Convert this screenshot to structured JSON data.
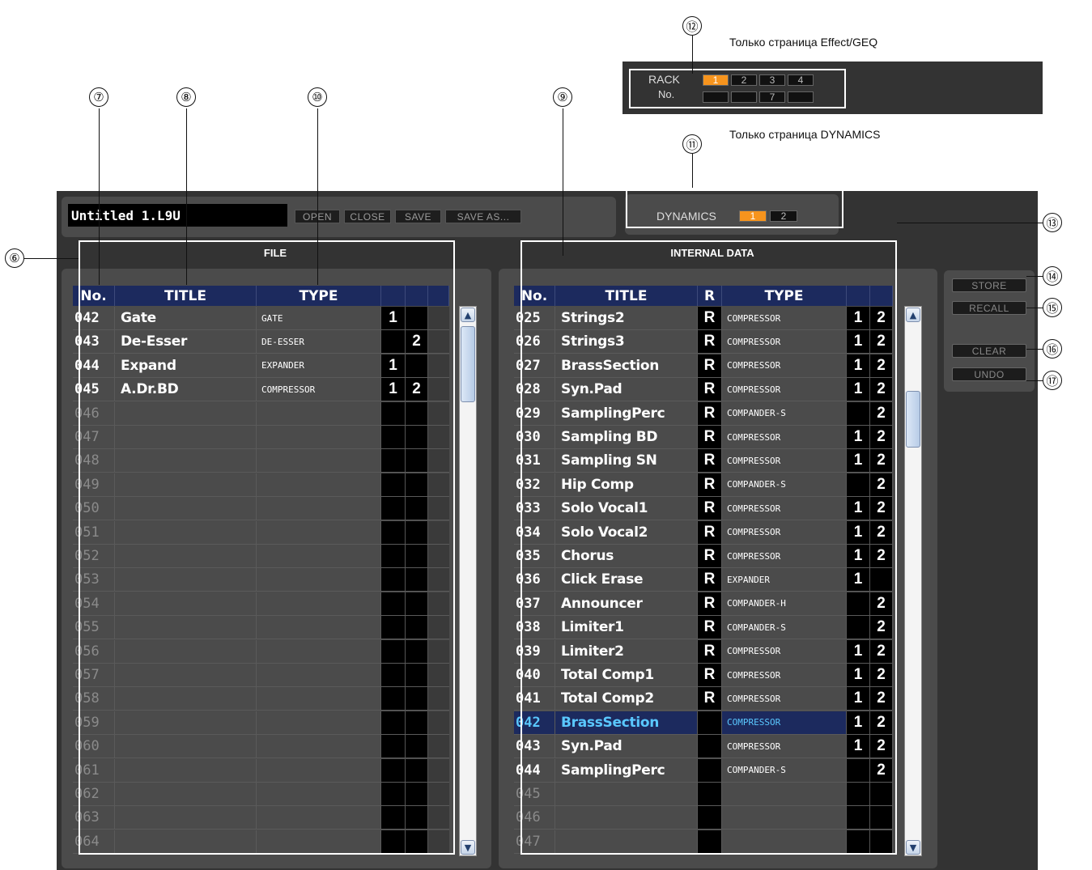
{
  "notes": {
    "effect_geq_only": "Только страница Effect/GEQ",
    "dynamics_only": "Только страница DYNAMICS"
  },
  "callouts": [
    "⑥",
    "⑦",
    "⑧",
    "⑨",
    "⑩",
    "⑪",
    "⑫",
    "⑬",
    "⑭",
    "⑮",
    "⑯",
    "⑰"
  ],
  "rack": {
    "label_line1": "RACK",
    "label_line2": "No.",
    "top_buttons": [
      "1",
      "2",
      "3",
      "4"
    ],
    "bottom_buttons": [
      "",
      "",
      "7",
      ""
    ],
    "active": "1",
    "active_color": "#f7941d"
  },
  "file_bar": {
    "filename": "Untitled 1.L9U",
    "open_label": "OPEN",
    "close_label": "CLOSE",
    "save_label": "SAVE",
    "save_as_label": "SAVE AS..."
  },
  "dynamics": {
    "label": "DYNAMICS",
    "buttons": [
      "1",
      "2"
    ],
    "active": "1"
  },
  "file_panel": {
    "title": "FILE",
    "headers": {
      "no": "No.",
      "title": "TITLE",
      "type": "TYPE"
    },
    "rows": [
      {
        "no": "042",
        "title": "Gate",
        "type": "GATE",
        "ch1": "1",
        "ch2": ""
      },
      {
        "no": "043",
        "title": "De-Esser",
        "type": "DE-ESSER",
        "ch1": "",
        "ch2": "2"
      },
      {
        "no": "044",
        "title": "Expand",
        "type": "EXPANDER",
        "ch1": "1",
        "ch2": ""
      },
      {
        "no": "045",
        "title": "A.Dr.BD",
        "type": "COMPRESSOR",
        "ch1": "1",
        "ch2": "2"
      },
      {
        "no": "046",
        "title": "",
        "type": "",
        "ch1": "",
        "ch2": ""
      },
      {
        "no": "047",
        "title": "",
        "type": "",
        "ch1": "",
        "ch2": ""
      },
      {
        "no": "048",
        "title": "",
        "type": "",
        "ch1": "",
        "ch2": ""
      },
      {
        "no": "049",
        "title": "",
        "type": "",
        "ch1": "",
        "ch2": ""
      },
      {
        "no": "050",
        "title": "",
        "type": "",
        "ch1": "",
        "ch2": ""
      },
      {
        "no": "051",
        "title": "",
        "type": "",
        "ch1": "",
        "ch2": ""
      },
      {
        "no": "052",
        "title": "",
        "type": "",
        "ch1": "",
        "ch2": ""
      },
      {
        "no": "053",
        "title": "",
        "type": "",
        "ch1": "",
        "ch2": ""
      },
      {
        "no": "054",
        "title": "",
        "type": "",
        "ch1": "",
        "ch2": ""
      },
      {
        "no": "055",
        "title": "",
        "type": "",
        "ch1": "",
        "ch2": ""
      },
      {
        "no": "056",
        "title": "",
        "type": "",
        "ch1": "",
        "ch2": ""
      },
      {
        "no": "057",
        "title": "",
        "type": "",
        "ch1": "",
        "ch2": ""
      },
      {
        "no": "058",
        "title": "",
        "type": "",
        "ch1": "",
        "ch2": ""
      },
      {
        "no": "059",
        "title": "",
        "type": "",
        "ch1": "",
        "ch2": ""
      },
      {
        "no": "060",
        "title": "",
        "type": "",
        "ch1": "",
        "ch2": ""
      },
      {
        "no": "061",
        "title": "",
        "type": "",
        "ch1": "",
        "ch2": ""
      },
      {
        "no": "062",
        "title": "",
        "type": "",
        "ch1": "",
        "ch2": ""
      },
      {
        "no": "063",
        "title": "",
        "type": "",
        "ch1": "",
        "ch2": ""
      },
      {
        "no": "064",
        "title": "",
        "type": "",
        "ch1": "",
        "ch2": ""
      }
    ]
  },
  "internal_panel": {
    "title": "INTERNAL DATA",
    "headers": {
      "no": "No.",
      "title": "TITLE",
      "r": "R",
      "type": "TYPE"
    },
    "rows": [
      {
        "no": "025",
        "title": "Strings2",
        "r": "R",
        "type": "COMPRESSOR",
        "ch1": "1",
        "ch2": "2"
      },
      {
        "no": "026",
        "title": "Strings3",
        "r": "R",
        "type": "COMPRESSOR",
        "ch1": "1",
        "ch2": "2"
      },
      {
        "no": "027",
        "title": "BrassSection",
        "r": "R",
        "type": "COMPRESSOR",
        "ch1": "1",
        "ch2": "2"
      },
      {
        "no": "028",
        "title": "Syn.Pad",
        "r": "R",
        "type": "COMPRESSOR",
        "ch1": "1",
        "ch2": "2"
      },
      {
        "no": "029",
        "title": "SamplingPerc",
        "r": "R",
        "type": "COMPANDER-S",
        "ch1": "",
        "ch2": "2"
      },
      {
        "no": "030",
        "title": "Sampling BD",
        "r": "R",
        "type": "COMPRESSOR",
        "ch1": "1",
        "ch2": "2"
      },
      {
        "no": "031",
        "title": "Sampling SN",
        "r": "R",
        "type": "COMPRESSOR",
        "ch1": "1",
        "ch2": "2"
      },
      {
        "no": "032",
        "title": "Hip Comp",
        "r": "R",
        "type": "COMPANDER-S",
        "ch1": "",
        "ch2": "2"
      },
      {
        "no": "033",
        "title": "Solo Vocal1",
        "r": "R",
        "type": "COMPRESSOR",
        "ch1": "1",
        "ch2": "2"
      },
      {
        "no": "034",
        "title": "Solo Vocal2",
        "r": "R",
        "type": "COMPRESSOR",
        "ch1": "1",
        "ch2": "2"
      },
      {
        "no": "035",
        "title": "Chorus",
        "r": "R",
        "type": "COMPRESSOR",
        "ch1": "1",
        "ch2": "2"
      },
      {
        "no": "036",
        "title": "Click Erase",
        "r": "R",
        "type": "EXPANDER",
        "ch1": "1",
        "ch2": ""
      },
      {
        "no": "037",
        "title": "Announcer",
        "r": "R",
        "type": "COMPANDER-H",
        "ch1": "",
        "ch2": "2"
      },
      {
        "no": "038",
        "title": "Limiter1",
        "r": "R",
        "type": "COMPANDER-S",
        "ch1": "",
        "ch2": "2"
      },
      {
        "no": "039",
        "title": "Limiter2",
        "r": "R",
        "type": "COMPRESSOR",
        "ch1": "1",
        "ch2": "2"
      },
      {
        "no": "040",
        "title": "Total Comp1",
        "r": "R",
        "type": "COMPRESSOR",
        "ch1": "1",
        "ch2": "2"
      },
      {
        "no": "041",
        "title": "Total Comp2",
        "r": "R",
        "type": "COMPRESSOR",
        "ch1": "1",
        "ch2": "2"
      },
      {
        "no": "042",
        "title": "BrassSection",
        "r": "",
        "type": "COMPRESSOR",
        "ch1": "1",
        "ch2": "2",
        "selected": true
      },
      {
        "no": "043",
        "title": "Syn.Pad",
        "r": "",
        "type": "COMPRESSOR",
        "ch1": "1",
        "ch2": "2"
      },
      {
        "no": "044",
        "title": "SamplingPerc",
        "r": "",
        "type": "COMPANDER-S",
        "ch1": "",
        "ch2": "2"
      },
      {
        "no": "045",
        "title": "",
        "r": "",
        "type": "",
        "ch1": "",
        "ch2": ""
      },
      {
        "no": "046",
        "title": "",
        "r": "",
        "type": "",
        "ch1": "",
        "ch2": ""
      },
      {
        "no": "047",
        "title": "",
        "r": "",
        "type": "",
        "ch1": "",
        "ch2": ""
      }
    ]
  },
  "side_buttons": {
    "store": "STORE",
    "recall": "RECALL",
    "clear": "CLEAR",
    "undo": "UNDO"
  },
  "colors": {
    "header_blue": "#1c2a5e",
    "selected_text": "#5ac8ff",
    "active_orange": "#f7941d"
  }
}
